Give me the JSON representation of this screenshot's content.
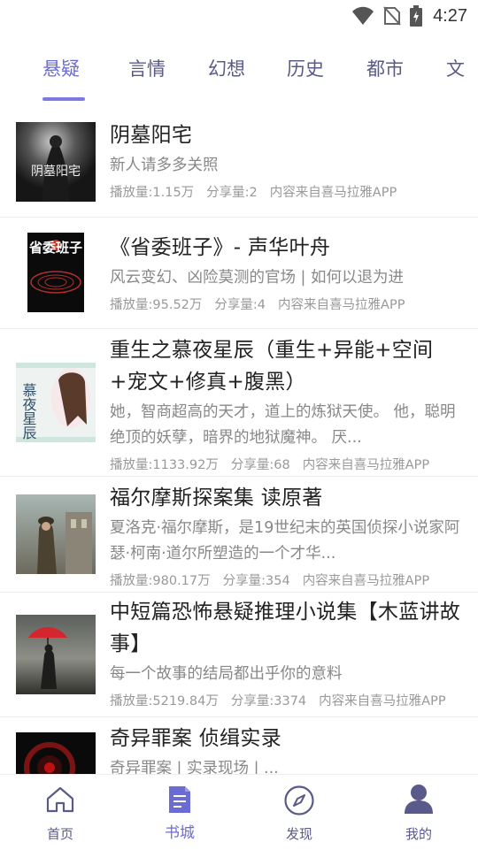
{
  "status": {
    "time": "4:27"
  },
  "tabs": [
    {
      "label": "悬疑",
      "active": true
    },
    {
      "label": "言情"
    },
    {
      "label": "幻想"
    },
    {
      "label": "历史"
    },
    {
      "label": "都市"
    },
    {
      "label": "文"
    }
  ],
  "items": [
    {
      "title": "阴墓阳宅",
      "desc": "新人请多多关照",
      "plays": "播放量:1.15万",
      "shares": "分享量:2",
      "source": "内容来自喜马拉雅APP",
      "cover_text": "阴墓阳宅"
    },
    {
      "title": "《省委班子》- 声华叶舟",
      "desc": "风云变幻、凶险莫测的官场 | 如何以退为进",
      "plays": "播放量:95.52万",
      "shares": "分享量:4",
      "source": "内容来自喜马拉雅APP",
      "cover_text": "省委班子"
    },
    {
      "title": "重生之慕夜星辰（重生+异能+空间+宠文+修真+腹黑）",
      "desc": "她，智商超高的天才，道上的炼狱天使。 他，聪明绝顶的妖孽，暗界的地狱魔神。 厌...",
      "plays": "播放量:1133.92万",
      "shares": "分享量:68",
      "source": "内容来自喜马拉雅APP",
      "cover_text": "慕夜星辰"
    },
    {
      "title": "福尔摩斯探案集 读原著",
      "desc": "夏洛克·福尔摩斯，是19世纪末的英国侦探小说家阿瑟·柯南·道尔所塑造的一个才华...",
      "plays": "播放量:980.17万",
      "shares": "分享量:354",
      "source": "内容来自喜马拉雅APP"
    },
    {
      "title": "中短篇恐怖悬疑推理小说集【木蓝讲故事】",
      "desc": "每一个故事的结局都出乎你的意料",
      "plays": "播放量:5219.84万",
      "shares": "分享量:3374",
      "source": "内容来自喜马拉雅APP"
    },
    {
      "title": "奇异罪案 侦缉实录",
      "desc": "奇异罪案 | 实录现场 | ..."
    }
  ],
  "nav": [
    {
      "label": "首页",
      "icon": "home-icon"
    },
    {
      "label": "书城",
      "icon": "book-icon",
      "active": true
    },
    {
      "label": "发现",
      "icon": "compass-icon"
    },
    {
      "label": "我的",
      "icon": "person-icon"
    }
  ],
  "colors": {
    "accent": "#6b6bd6",
    "tab_text": "#5a5a8a",
    "desc": "#888888",
    "meta": "#999999"
  }
}
